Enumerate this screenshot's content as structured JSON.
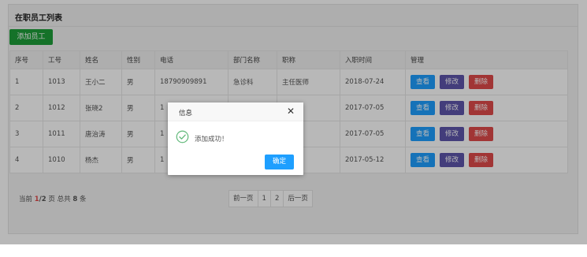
{
  "panel": {
    "title": "在职员工列表"
  },
  "toolbar": {
    "add_label": "添加员工"
  },
  "table": {
    "headers": [
      "序号",
      "工号",
      "姓名",
      "性别",
      "电话",
      "部门名称",
      "职称",
      "入职时间",
      "管理"
    ],
    "rows": [
      [
        "1",
        "1013",
        "王小二",
        "男",
        "18790909891",
        "急诊科",
        "主任医师",
        "2018-07-24"
      ],
      [
        "2",
        "1012",
        "张晓2",
        "男",
        "1",
        "",
        "部主任",
        "2017-07-05"
      ],
      [
        "3",
        "1011",
        "唐治涛",
        "男",
        "1",
        "",
        "",
        "2017-07-05"
      ],
      [
        "4",
        "1010",
        "杨杰",
        "男",
        "1",
        "",
        "部员工",
        "2017-05-12"
      ]
    ],
    "actions": {
      "view": "查看",
      "edit": "修改",
      "delete": "删除"
    }
  },
  "pagination": {
    "current_prefix": "当前",
    "current": "1",
    "total_pages": "2",
    "page_suffix": "页",
    "total_prefix": "总共",
    "total_count": "8",
    "total_suffix": "条",
    "prev": "前一页",
    "pages": [
      "1",
      "2"
    ],
    "next": "后一页"
  },
  "dialog": {
    "title": "信息",
    "close": "✕",
    "message": "添加成功！",
    "ok": "确定",
    "icon": "check-circle-icon"
  },
  "colors": {
    "add_button": "#1e9f3a",
    "view_button": "#1e9fff",
    "edit_button": "#5d55ab",
    "delete_button": "#e04a4a",
    "success_icon": "#5fb878"
  }
}
